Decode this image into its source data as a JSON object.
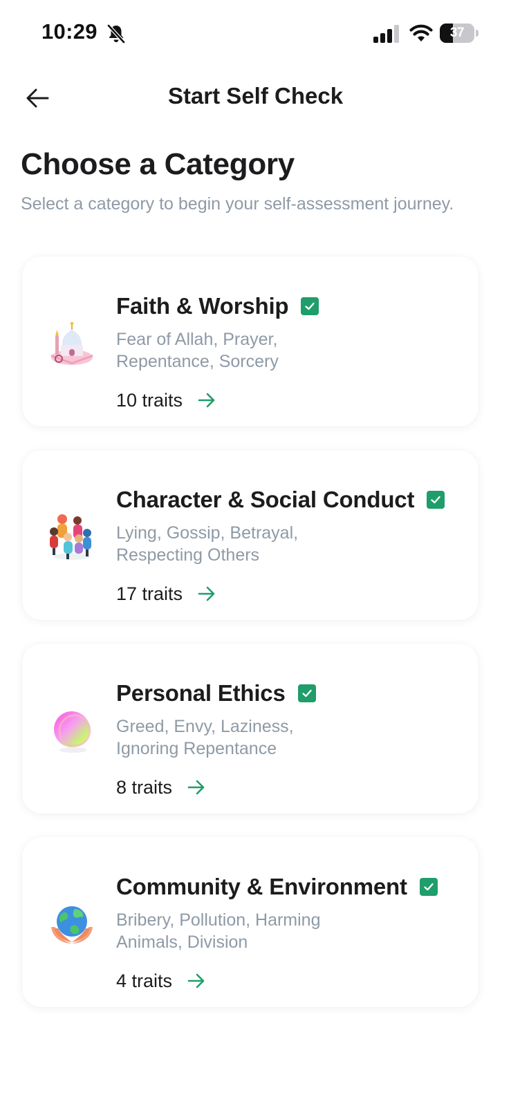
{
  "status_bar": {
    "time": "10:29",
    "battery": "37",
    "battery_level_percent": 37,
    "icons": [
      "bell-slash-icon",
      "cellular-signal-icon",
      "wifi-icon",
      "battery-icon"
    ]
  },
  "header": {
    "title": "Start Self Check",
    "back_icon": "arrow-left-icon"
  },
  "main": {
    "title": "Choose a Category",
    "subtitle": "Select a category to begin your self-assessment journey."
  },
  "colors": {
    "accent": "#1f9d6a",
    "muted_text": "#8e9aa6",
    "text": "#1c1c1e"
  },
  "categories": [
    {
      "title": "Faith & Worship",
      "description": "Fear of Allah, Prayer, Repentance, Sorcery",
      "traits": "10 traits",
      "icon": "mosque-icon",
      "selected": true
    },
    {
      "title": "Character & Social Conduct",
      "description": "Lying, Gossip, Betrayal, Respecting Others",
      "traits": "17 traits",
      "icon": "people-circle-icon",
      "selected": true
    },
    {
      "title": "Personal Ethics",
      "description": "Greed, Envy, Laziness, Ignoring Repentance",
      "traits": "8 traits",
      "icon": "gradient-orb-icon",
      "selected": true
    },
    {
      "title": "Community & Environment",
      "description": "Bribery, Pollution, Harming Animals, Division",
      "traits": "4 traits",
      "icon": "globe-in-hands-icon",
      "selected": true
    }
  ]
}
